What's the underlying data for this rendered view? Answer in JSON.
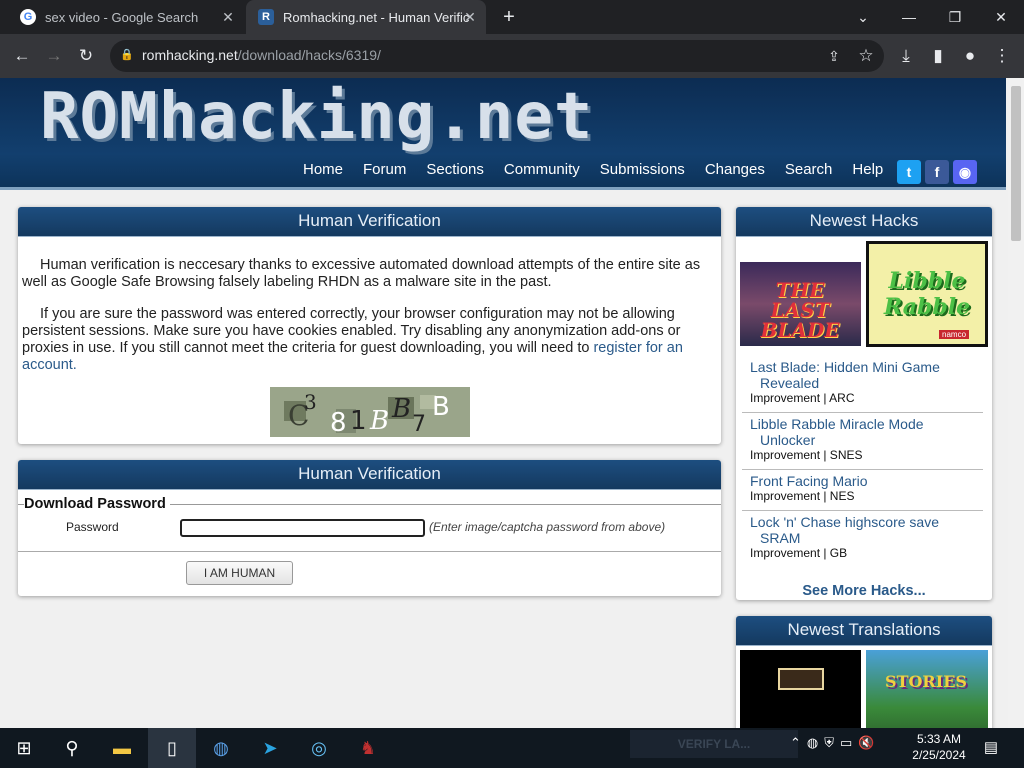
{
  "browser": {
    "tabs": [
      {
        "title": "sex video - Google Search",
        "favicon": "google-favicon",
        "active": false
      },
      {
        "title": "Romhacking.net - Human Verific",
        "favicon": "romhacking-favicon",
        "active": true
      }
    ],
    "url_host": "romhacking.net",
    "url_path": "/download/hacks/6319/"
  },
  "site": {
    "logo": "ROMhacking.net",
    "nav": [
      "Home",
      "Forum",
      "Sections",
      "Community",
      "Submissions",
      "Changes",
      "Search",
      "Help"
    ],
    "social": [
      "twitter-icon",
      "facebook-icon",
      "discord-icon"
    ]
  },
  "verification": {
    "heading": "Human Verification",
    "para1": "Human verification is neccesary thanks to excessive automated download attempts of the entire site as well as Google Safe Browsing falsely labeling RHDN as a malware site in the past.",
    "para2": "If you are sure the password was entered correctly, your browser configuration may not be allowing persistent sessions. Make sure you have cookies enabled. Try disabling any anonymization add-ons or proxies in use. If you still cannot meet the criteria for guest downloading, you will need to",
    "register_link": "register for an account.",
    "captcha_text": "C381BB7B"
  },
  "download_form": {
    "heading": "Human Verification",
    "legend": "Download Password",
    "password_label": "Password",
    "password_value": "",
    "hint": "(Enter image/captcha password from above)",
    "submit_label": "I AM HUMAN"
  },
  "newest_hacks": {
    "heading": "Newest Hacks",
    "items": [
      {
        "title_line1": "Last Blade: Hidden Mini Game",
        "title_line2": "Revealed",
        "meta": "Improvement | ARC"
      },
      {
        "title_line1": "Libble Rabble Miracle Mode",
        "title_line2": "Unlocker",
        "meta": "Improvement | SNES"
      },
      {
        "title_line1": "Front Facing Mario",
        "title_line2": "",
        "meta": "Improvement | NES"
      },
      {
        "title_line1": "Lock 'n' Chase highscore save",
        "title_line2": "SRAM",
        "meta": "Improvement | GB"
      }
    ],
    "see_more": "See More Hacks...",
    "thumb1_text": "THE LAST BLADE",
    "thumb2_text": "Libble Rabble",
    "thumb2_sub": "namco"
  },
  "newest_translations": {
    "heading": "Newest Translations",
    "thumb2_text": "STORIES"
  },
  "taskbar": {
    "overlay_text": "VERIFY LA...",
    "time": "5:33 AM",
    "date": "2/25/2024"
  },
  "colors": {
    "banner": "#123f6e",
    "link": "#2a5a8a",
    "chrome_dark": "#202124"
  }
}
